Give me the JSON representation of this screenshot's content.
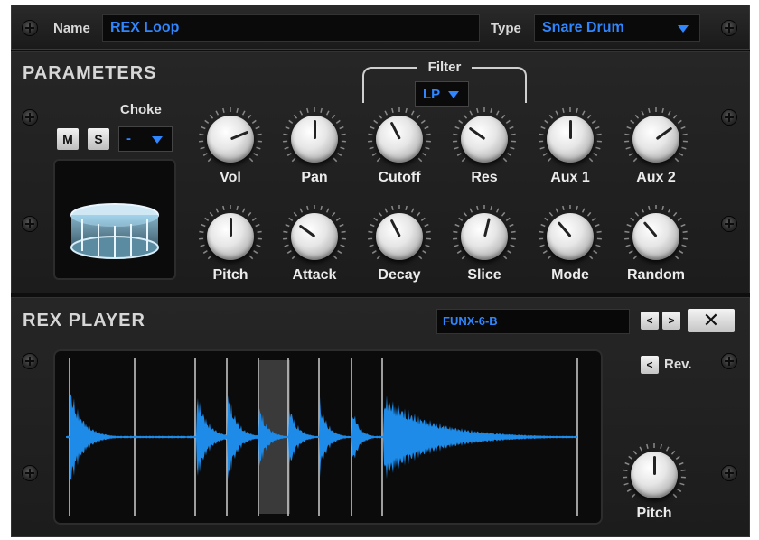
{
  "header": {
    "name_label": "Name",
    "name_value": "REX Loop",
    "type_label": "Type",
    "type_value": "Snare Drum"
  },
  "parameters": {
    "title": "PARAMETERS",
    "filter_label": "Filter",
    "filter_value": "LP",
    "mute_label": "M",
    "solo_label": "S",
    "choke_label": "Choke",
    "choke_value": "-",
    "knobs_row1": [
      {
        "label": "Vol",
        "value": 0.75
      },
      {
        "label": "Pan",
        "value": 0.5
      },
      {
        "label": "Cutoff",
        "value": 0.4
      },
      {
        "label": "Res",
        "value": 0.3
      },
      {
        "label": "Aux 1",
        "value": 0.5
      },
      {
        "label": "Aux 2",
        "value": 0.7
      }
    ],
    "knobs_row2": [
      {
        "label": "Pitch",
        "value": 0.5
      },
      {
        "label": "Attack",
        "value": 0.3
      },
      {
        "label": "Decay",
        "value": 0.4
      },
      {
        "label": "Slice",
        "value": 0.55
      },
      {
        "label": "Mode",
        "value": 0.35
      },
      {
        "label": "Random",
        "value": 0.35
      }
    ]
  },
  "rex_player": {
    "title": "REX PLAYER",
    "loop_name": "FUNX-6-B",
    "prev_label": "<",
    "next_label": ">",
    "close_label": "✕",
    "rev_button_label": "<",
    "rev_label": "Rev.",
    "pitch_label": "Pitch",
    "pitch_value": 0.5,
    "slice_count": 8,
    "selected_slice": 3
  },
  "colors": {
    "accent": "#2f86ff",
    "waveform": "#1f8be8",
    "panel": "#222222"
  }
}
